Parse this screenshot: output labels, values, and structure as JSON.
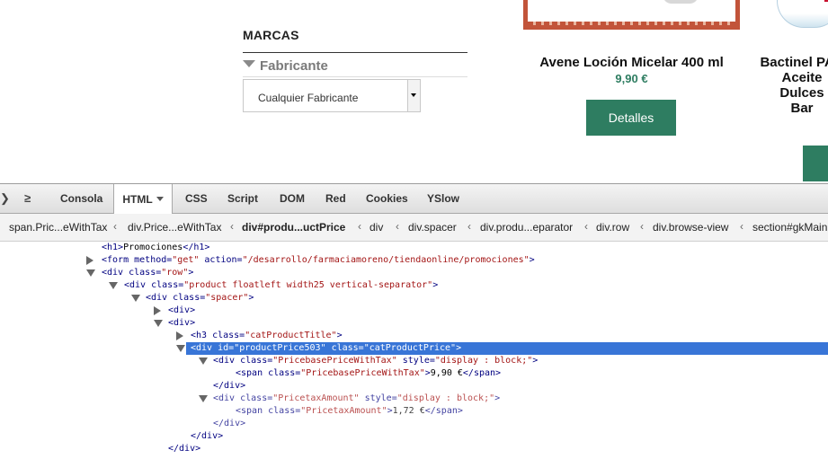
{
  "site": {
    "brands_title": "MARCAS",
    "manufacturer_label": "Fabricante",
    "manufacturer_select_value": "Cualquier Fabricante",
    "product1": {
      "title": "Avene Loción Micelar 400 ml",
      "price": "9,90 €",
      "button": "Detalles"
    },
    "product2": {
      "title_lines": [
        "Bactinel PAC",
        "Aceite",
        "Dulces",
        "Bar"
      ]
    },
    "colors": {
      "accent_green": "#2e7d61",
      "frame_red": "#c2543a"
    }
  },
  "devtools": {
    "tabs": [
      {
        "label": "Consola"
      },
      {
        "label": "HTML"
      },
      {
        "label": "CSS"
      },
      {
        "label": "Script"
      },
      {
        "label": "DOM"
      },
      {
        "label": "Red"
      },
      {
        "label": "Cookies"
      },
      {
        "label": "YSlow"
      }
    ],
    "active_tab": "HTML",
    "breadcrumbs": [
      "span.Pric...eWithTax",
      "div.Price...eWithTax",
      "div#produ...uctPrice",
      "div",
      "div.spacer",
      "div.produ...eparator",
      "div.row",
      "div.browse-view",
      "section#gkMainb"
    ],
    "tree": [
      {
        "tag_open": "<h1>",
        "text": "Promociones",
        "tag_close": "</h1>"
      },
      {
        "tag_open": "<form",
        "attrs": [
          [
            "method",
            "\"get\""
          ],
          [
            "action",
            "\"/desarrollo/farmaciamoreno/tiendaonline/promociones\""
          ]
        ],
        "end": ">"
      },
      {
        "tag_open": "<div",
        "attrs": [
          [
            "class",
            "\"row\""
          ]
        ],
        "end": ">"
      },
      {
        "tag_open": "<div",
        "attrs": [
          [
            "class",
            "\"product floatleft width25 vertical-separator\""
          ]
        ],
        "end": ">"
      },
      {
        "tag_open": "<div",
        "attrs": [
          [
            "class",
            "\"spacer\""
          ]
        ],
        "end": ">"
      },
      {
        "tag_open": "<div>"
      },
      {
        "tag_open": "<div>"
      },
      {
        "tag_open": "<h3",
        "attrs": [
          [
            "class",
            "\"catProductTitle\""
          ]
        ],
        "end": ">"
      },
      {
        "tag_open": "<div",
        "attrs": [
          [
            "id",
            "\"productPrice503\""
          ],
          [
            "class",
            "\"catProductPrice\""
          ]
        ],
        "end": ">"
      },
      {
        "tag_open": "<div",
        "attrs": [
          [
            "class",
            "\"PricebasePriceWithTax\""
          ],
          [
            "style",
            "\"display : block;\""
          ]
        ],
        "end": ">"
      },
      {
        "tag_open": "<span",
        "attrs": [
          [
            "class",
            "\"PricebasePriceWithTax\""
          ]
        ],
        "end": ">",
        "text": "9,90 €",
        "tag_close": "</span>"
      },
      {
        "tag_open": "</div>"
      },
      {
        "tag_open": "<div",
        "attrs": [
          [
            "class",
            "\"PricetaxAmount\""
          ],
          [
            "style",
            "\"display : block;\""
          ]
        ],
        "end": ">"
      },
      {
        "tag_open": "<span",
        "attrs": [
          [
            "class",
            "\"PricetaxAmount\""
          ]
        ],
        "end": ">",
        "text": "1,72 €",
        "tag_close": "</span>"
      },
      {
        "tag_open": "</div>"
      },
      {
        "tag_open": "</div>"
      },
      {
        "tag_open": "</div>"
      }
    ]
  }
}
